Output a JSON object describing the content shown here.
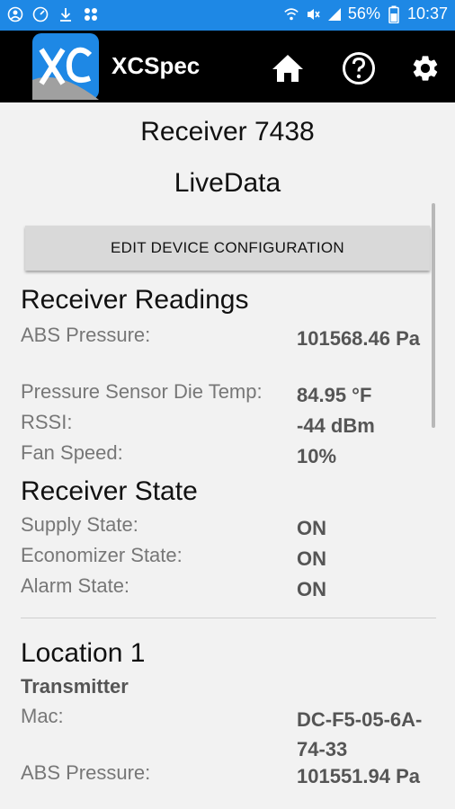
{
  "status_bar": {
    "battery_percent": "56%",
    "time": "10:37",
    "left_icons": [
      "account-circle-icon",
      "speedometer-icon",
      "download-icon",
      "apps-icon"
    ],
    "right_icons": [
      "wifi-icon",
      "mute-icon",
      "signal-icon",
      "battery-icon"
    ]
  },
  "app_bar": {
    "title": "XCSpec",
    "logo_text": "XC",
    "icons": [
      "home-icon",
      "help-icon",
      "settings-icon"
    ],
    "colors": {
      "background": "#000000",
      "logo_blue": "#1e88e5"
    }
  },
  "page": {
    "device_title": "Receiver 7438",
    "subtitle": "LiveData",
    "edit_button_label": "EDIT DEVICE CONFIGURATION"
  },
  "receiver_readings": {
    "heading": "Receiver Readings",
    "rows": [
      {
        "label": "ABS Pressure:",
        "value": "101568.46 Pa"
      },
      {
        "label": "Pressure Sensor Die Temp:",
        "value": "84.95 °F"
      },
      {
        "label": "RSSI:",
        "value": "-44 dBm"
      },
      {
        "label": "Fan Speed:",
        "value": "10%"
      }
    ]
  },
  "receiver_state": {
    "heading": "Receiver State",
    "rows": [
      {
        "label": "Supply State:",
        "value": "ON"
      },
      {
        "label": "Economizer State:",
        "value": "ON"
      },
      {
        "label": "Alarm State:",
        "value": "ON"
      }
    ]
  },
  "location": {
    "heading": "Location 1",
    "subheading": "Transmitter",
    "rows": [
      {
        "label": "Mac:",
        "value": "DC-F5-05-6A-74-33"
      },
      {
        "label": "ABS Pressure:",
        "value": "101551.94 Pa"
      }
    ]
  }
}
